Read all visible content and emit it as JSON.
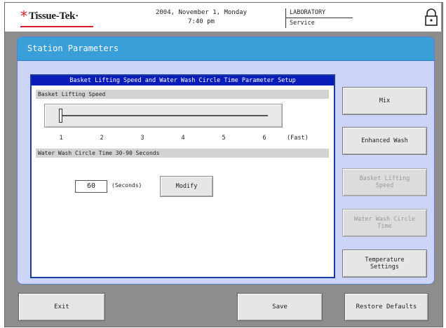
{
  "header": {
    "brand": "Tissue-Tek",
    "brand_mark": "*",
    "brand_suffix": "·",
    "date": "2004, November 1, Monday",
    "time": "7:40 pm",
    "location": "LABORATORY",
    "role": "Service",
    "lock_icon": "padlock-icon"
  },
  "page": {
    "title": "Station Parameters"
  },
  "setup": {
    "title": "Basket Lifting Speed and Water Wash Circle Time Parameter Setup",
    "lifting_speed": {
      "label": "Basket Lifting Speed",
      "min": 1,
      "max": 6,
      "value": 1,
      "ticks": [
        "1",
        "2",
        "3",
        "4",
        "5",
        "6"
      ],
      "fast_label": "(Fast)"
    },
    "wash_time": {
      "label": "Water Wash Circle Time   30-90 Seconds",
      "value": "60",
      "unit": "(Seconds)",
      "modify_label": "Modify"
    }
  },
  "side_buttons": [
    {
      "label": "Mix",
      "enabled": true
    },
    {
      "label": "Enhanced Wash",
      "enabled": true
    },
    {
      "label": "Basket Lifting\nSpeed",
      "enabled": false
    },
    {
      "label": "Water Wash Circle\nTime",
      "enabled": false
    },
    {
      "label": "Temperature\nSettings",
      "enabled": true
    }
  ],
  "footer": {
    "exit_label": "Exit",
    "save_label": "Save",
    "restore_label": "Restore Defaults"
  },
  "colors": {
    "title_bar": "#3a9ed9",
    "panel_bg": "#ccd5f7",
    "setup_title_bg": "#0a1cb8",
    "brand_red": "#d3202a"
  }
}
